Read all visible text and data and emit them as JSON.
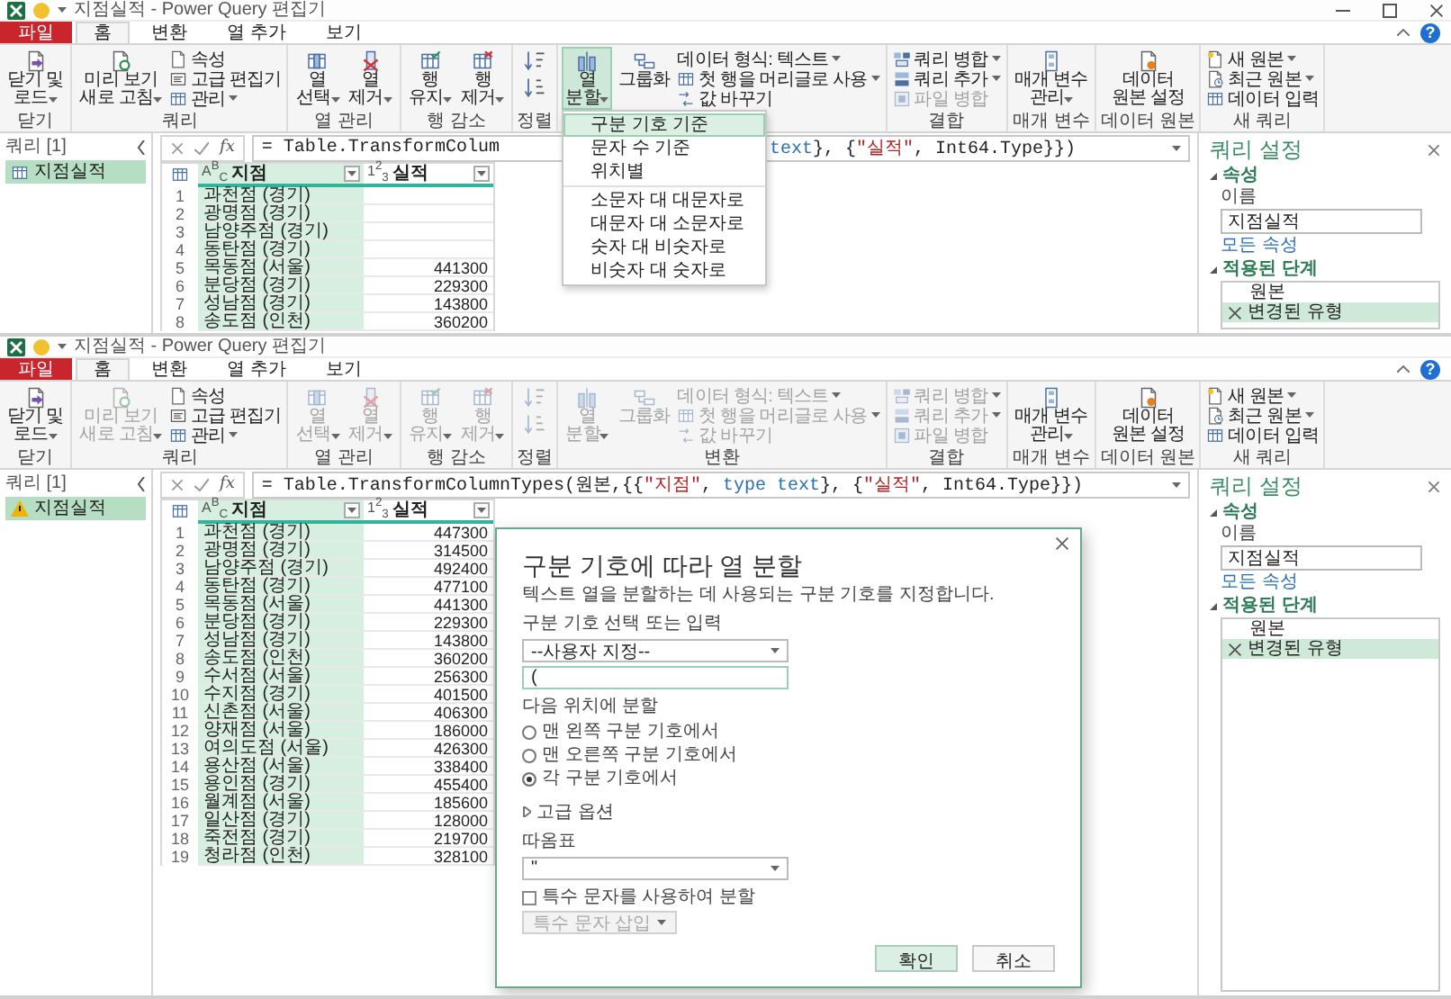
{
  "windows": [
    {
      "title": "지점실적 - Power Query 편집기",
      "window_controls": true,
      "help": "?",
      "tabs": [
        {
          "label": "파일",
          "kind": "file",
          "selected": false
        },
        {
          "label": "홈",
          "kind": "tab",
          "selected": true
        },
        {
          "label": "변환",
          "kind": "tab",
          "selected": false
        },
        {
          "label": "열 추가",
          "kind": "tab",
          "selected": false
        },
        {
          "label": "보기",
          "kind": "tab",
          "selected": false
        }
      ],
      "ribbon": [
        {
          "label": "닫기",
          "items": [
            {
              "kind": "large",
              "lines": [
                "닫기 및",
                "로드"
              ],
              "dropdown": true,
              "disabled": false,
              "pressed": false
            }
          ]
        },
        {
          "label": "쿼리",
          "items": [
            {
              "kind": "large",
              "lines": [
                "미리 보기",
                "새로 고침"
              ],
              "dropdown": true,
              "disabled": false,
              "pressed": false
            },
            {
              "kind": "stack",
              "items": [
                {
                  "label": "속성",
                  "dropdown": false,
                  "disabled": false
                },
                {
                  "label": "고급 편집기",
                  "dropdown": false,
                  "disabled": false
                },
                {
                  "label": "관리",
                  "dropdown": true,
                  "disabled": false
                }
              ]
            }
          ]
        },
        {
          "label": "열 관리",
          "items": [
            {
              "kind": "large",
              "lines": [
                "열",
                "선택"
              ],
              "dropdown": true,
              "disabled": false,
              "pressed": false
            },
            {
              "kind": "large",
              "lines": [
                "열",
                "제거"
              ],
              "dropdown": true,
              "disabled": false,
              "pressed": false
            }
          ]
        },
        {
          "label": "행 감소",
          "items": [
            {
              "kind": "large",
              "lines": [
                "행",
                "유지"
              ],
              "dropdown": true,
              "disabled": false,
              "pressed": false
            },
            {
              "kind": "large",
              "lines": [
                "행",
                "제거"
              ],
              "dropdown": true,
              "disabled": false,
              "pressed": false
            }
          ]
        },
        {
          "label": "정렬",
          "items": [
            {
              "kind": "icons",
              "items": [
                {
                  "disabled": false
                },
                {
                  "disabled": false
                }
              ]
            }
          ]
        },
        {
          "items": [
            {
              "kind": "large",
              "lines": [
                "열",
                "분할"
              ],
              "dropdown": true,
              "disabled": false,
              "pressed": true
            },
            {
              "kind": "large",
              "lines": [
                "그룹화"
              ],
              "dropdown": false,
              "disabled": false,
              "pressed": false
            },
            {
              "kind": "stack",
              "items": [
                {
                  "label": "데이터 형식: 텍스트",
                  "dropdown": true,
                  "disabled": false
                },
                {
                  "label": "첫 행을 머리글로 사용",
                  "dropdown": true,
                  "disabled": false
                },
                {
                  "label": "값 바꾸기",
                  "dropdown": false,
                  "disabled": false
                }
              ]
            }
          ]
        },
        {
          "label": "결합",
          "items": [
            {
              "kind": "stack",
              "items": [
                {
                  "label": "쿼리 병합",
                  "dropdown": true,
                  "disabled": false
                },
                {
                  "label": "쿼리 추가",
                  "dropdown": true,
                  "disabled": false
                },
                {
                  "label": "파일 병합",
                  "dropdown": false,
                  "disabled": true
                }
              ]
            }
          ]
        },
        {
          "label": "매개 변수",
          "items": [
            {
              "kind": "large",
              "lines": [
                "매개 변수",
                "관리"
              ],
              "dropdown": true,
              "disabled": false,
              "pressed": false
            }
          ]
        },
        {
          "label": "데이터 원본",
          "items": [
            {
              "kind": "large",
              "lines": [
                "데이터",
                "원본 설정"
              ],
              "dropdown": false,
              "disabled": false,
              "pressed": false
            }
          ]
        },
        {
          "label": "새 쿼리",
          "items": [
            {
              "kind": "stack",
              "items": [
                {
                  "label": "새 원본",
                  "dropdown": true,
                  "disabled": false
                },
                {
                  "label": "최근 원본",
                  "dropdown": true,
                  "disabled": false
                },
                {
                  "label": "데이터 입력",
                  "dropdown": false,
                  "disabled": false
                }
              ]
            }
          ]
        }
      ],
      "menu": {
        "sections": [
          [
            {
              "label": "구분 기호 기준",
              "selected": true
            },
            {
              "label": "문자 수 기준",
              "selected": false
            },
            {
              "label": "위치별",
              "selected": false
            }
          ],
          [
            {
              "label": "소문자 대 대문자로",
              "selected": false
            },
            {
              "label": "대문자 대 소문자로",
              "selected": false
            },
            {
              "label": "숫자 대 비숫자로",
              "selected": false
            },
            {
              "label": "비숫자 대 숫자로",
              "selected": false
            }
          ]
        ]
      },
      "queries": {
        "title": "쿼리 [1]",
        "items": [
          {
            "label": "지점실적",
            "kind": "table",
            "selected": true
          }
        ]
      },
      "fx": "fx",
      "formula": [
        [
          {
            "kind": "plain",
            "text": "= Table.TransformColum"
          }
        ],
        [
          {
            "kind": "keyword",
            "text": "text"
          },
          {
            "kind": "plain",
            "text": "}, {"
          },
          {
            "kind": "string",
            "text": "\"실적\""
          },
          {
            "kind": "plain",
            "text": ", Int64.Type}})"
          }
        ]
      ],
      "table": {
        "columns": [
          {
            "type_label": "A$^{B}$$_{C}$",
            "name": "지점",
            "selected": true
          },
          {
            "type_label": "1$^{2}$$_{3}$",
            "name": "실적",
            "selected": false
          }
        ],
        "rows": [
          {
            "n": "1",
            "cells": [
              "과천점 (경기)"
            ]
          },
          {
            "n": "2",
            "cells": [
              "광명점 (경기)"
            ]
          },
          {
            "n": "3",
            "cells": [
              "남양주점 (경기)"
            ]
          },
          {
            "n": "4",
            "cells": [
              "동탄점 (경기)"
            ]
          },
          {
            "n": "5",
            "cells": [
              "목동점 (서울)",
              "441300"
            ]
          },
          {
            "n": "6",
            "cells": [
              "분당점 (경기)",
              "229300"
            ]
          },
          {
            "n": "7",
            "cells": [
              "성남점 (경기)",
              "143800"
            ]
          },
          {
            "n": "8",
            "cells": [
              "송도점 (인천)",
              "360200"
            ]
          }
        ]
      },
      "settings": {
        "title": "쿼리 설정",
        "properties": "속성",
        "name_label": "이름",
        "name_value": "지점실적",
        "all_properties": "모든 속성",
        "steps_label": "적용된 단계",
        "steps": [
          {
            "label": "원본",
            "selected": false
          },
          {
            "label": "변경된 유형",
            "selected": true
          }
        ]
      }
    },
    {
      "title": "지점실적 - Power Query 편집기",
      "window_controls": false,
      "help": "?",
      "tabs": [
        {
          "label": "파일",
          "kind": "file",
          "selected": false
        },
        {
          "label": "홈",
          "kind": "tab",
          "selected": true
        },
        {
          "label": "변환",
          "kind": "tab",
          "selected": false
        },
        {
          "label": "열 추가",
          "kind": "tab",
          "selected": false
        },
        {
          "label": "보기",
          "kind": "tab",
          "selected": false
        }
      ],
      "ribbon": [
        {
          "label": "닫기",
          "items": [
            {
              "kind": "large",
              "lines": [
                "닫기 및",
                "로드"
              ],
              "dropdown": true,
              "disabled": false,
              "pressed": false
            }
          ]
        },
        {
          "label": "쿼리",
          "items": [
            {
              "kind": "large",
              "lines": [
                "미리 보기",
                "새로 고침"
              ],
              "dropdown": true,
              "disabled": true,
              "pressed": false
            },
            {
              "kind": "stack",
              "items": [
                {
                  "label": "속성",
                  "dropdown": false,
                  "disabled": false
                },
                {
                  "label": "고급 편집기",
                  "dropdown": false,
                  "disabled": false
                },
                {
                  "label": "관리",
                  "dropdown": true,
                  "disabled": false
                }
              ]
            }
          ]
        },
        {
          "label": "열 관리",
          "items": [
            {
              "kind": "large",
              "lines": [
                "열",
                "선택"
              ],
              "dropdown": true,
              "disabled": true,
              "pressed": false
            },
            {
              "kind": "large",
              "lines": [
                "열",
                "제거"
              ],
              "dropdown": true,
              "disabled": true,
              "pressed": false
            }
          ]
        },
        {
          "label": "행 감소",
          "items": [
            {
              "kind": "large",
              "lines": [
                "행",
                "유지"
              ],
              "dropdown": true,
              "disabled": true,
              "pressed": false
            },
            {
              "kind": "large",
              "lines": [
                "행",
                "제거"
              ],
              "dropdown": true,
              "disabled": true,
              "pressed": false
            }
          ]
        },
        {
          "label": "정렬",
          "items": [
            {
              "kind": "icons",
              "items": [
                {
                  "disabled": true
                },
                {
                  "disabled": true
                }
              ]
            }
          ]
        },
        {
          "label": "변환",
          "items": [
            {
              "kind": "large",
              "lines": [
                "열",
                "분할"
              ],
              "dropdown": true,
              "disabled": true,
              "pressed": false
            },
            {
              "kind": "large",
              "lines": [
                "그룹화"
              ],
              "dropdown": false,
              "disabled": true,
              "pressed": false
            },
            {
              "kind": "stack",
              "items": [
                {
                  "label": "데이터 형식: 텍스트",
                  "dropdown": true,
                  "disabled": true
                },
                {
                  "label": "첫 행을 머리글로 사용",
                  "dropdown": true,
                  "disabled": true
                },
                {
                  "label": "값 바꾸기",
                  "dropdown": false,
                  "disabled": true
                }
              ]
            }
          ]
        },
        {
          "label": "결합",
          "items": [
            {
              "kind": "stack",
              "items": [
                {
                  "label": "쿼리 병합",
                  "dropdown": true,
                  "disabled": true
                },
                {
                  "label": "쿼리 추가",
                  "dropdown": true,
                  "disabled": true
                },
                {
                  "label": "파일 병합",
                  "dropdown": false,
                  "disabled": true
                }
              ]
            }
          ]
        },
        {
          "label": "매개 변수",
          "items": [
            {
              "kind": "large",
              "lines": [
                "매개 변수",
                "관리"
              ],
              "dropdown": true,
              "disabled": false,
              "pressed": false
            }
          ]
        },
        {
          "label": "데이터 원본",
          "items": [
            {
              "kind": "large",
              "lines": [
                "데이터",
                "원본 설정"
              ],
              "dropdown": false,
              "disabled": false,
              "pressed": false
            }
          ]
        },
        {
          "label": "새 쿼리",
          "items": [
            {
              "kind": "stack",
              "items": [
                {
                  "label": "새 원본",
                  "dropdown": true,
                  "disabled": false
                },
                {
                  "label": "최근 원본",
                  "dropdown": true,
                  "disabled": false
                },
                {
                  "label": "데이터 입력",
                  "dropdown": false,
                  "disabled": false
                }
              ]
            }
          ]
        }
      ],
      "queries": {
        "title": "쿼리 [1]",
        "items": [
          {
            "label": "지점실적",
            "kind": "warning",
            "selected": true
          }
        ]
      },
      "fx": "fx",
      "formula": [
        [
          {
            "kind": "plain",
            "text": "= Table.TransformColumnTypes(원본,{{"
          },
          {
            "kind": "string",
            "text": "\"지점\""
          },
          {
            "kind": "plain",
            "text": ", "
          },
          {
            "kind": "keyword",
            "text": "type text"
          },
          {
            "kind": "plain",
            "text": "}, {"
          },
          {
            "kind": "string",
            "text": "\"실적\""
          },
          {
            "kind": "plain",
            "text": ", Int64.Type}})"
          }
        ]
      ],
      "table": {
        "columns": [
          {
            "type_label": "A$^{B}$$_{C}$",
            "name": "지점",
            "selected": true
          },
          {
            "type_label": "1$^{2}$$_{3}$",
            "name": "실적",
            "selected": false
          }
        ],
        "rows": [
          {
            "n": "1",
            "cells": [
              "과천점 (경기)",
              "447300"
            ]
          },
          {
            "n": "2",
            "cells": [
              "광명점 (경기)",
              "314500"
            ]
          },
          {
            "n": "3",
            "cells": [
              "남양주점 (경기)",
              "492400"
            ]
          },
          {
            "n": "4",
            "cells": [
              "동탄점 (경기)",
              "477100"
            ]
          },
          {
            "n": "5",
            "cells": [
              "목동점 (서울)",
              "441300"
            ]
          },
          {
            "n": "6",
            "cells": [
              "분당점 (경기)",
              "229300"
            ]
          },
          {
            "n": "7",
            "cells": [
              "성남점 (경기)",
              "143800"
            ]
          },
          {
            "n": "8",
            "cells": [
              "송도점 (인천)",
              "360200"
            ]
          },
          {
            "n": "9",
            "cells": [
              "수서점 (서울)",
              "256300"
            ]
          },
          {
            "n": "10",
            "cells": [
              "수지점 (경기)",
              "401500"
            ]
          },
          {
            "n": "11",
            "cells": [
              "신촌점 (서울)",
              "406300"
            ]
          },
          {
            "n": "12",
            "cells": [
              "양재점 (서울)",
              "186000"
            ]
          },
          {
            "n": "13",
            "cells": [
              "여의도점 (서울)",
              "426300"
            ]
          },
          {
            "n": "14",
            "cells": [
              "용산점 (서울)",
              "338400"
            ]
          },
          {
            "n": "15",
            "cells": [
              "용인점 (경기)",
              "455400"
            ]
          },
          {
            "n": "16",
            "cells": [
              "월계점 (서울)",
              "185600"
            ]
          },
          {
            "n": "17",
            "cells": [
              "일산점 (경기)",
              "128000"
            ]
          },
          {
            "n": "18",
            "cells": [
              "죽전점 (경기)",
              "219700"
            ]
          },
          {
            "n": "19",
            "cells": [
              "청라점 (인천)",
              "328100"
            ]
          }
        ]
      },
      "settings": {
        "title": "쿼리 설정",
        "properties": "속성",
        "name_label": "이름",
        "name_value": "지점실적",
        "all_properties": "모든 속성",
        "steps_label": "적용된 단계",
        "steps": [
          {
            "label": "원본",
            "selected": false
          },
          {
            "label": "변경된 유형",
            "selected": true
          }
        ]
      },
      "dialog": {
        "title": "구분 기호에 따라 열 분할",
        "description": "텍스트 열을 분할하는 데 사용되는 구분 기호를 지정합니다.",
        "delimiter_label": "구분 기호 선택 또는 입력",
        "delimiter_select": "--사용자 지정--",
        "delimiter_value": "(",
        "split_label": "다음 위치에 분할",
        "split_options": [
          {
            "label": "맨 왼쪽 구분 기호에서",
            "selected": false
          },
          {
            "label": "맨 오른쪽 구분 기호에서",
            "selected": false
          },
          {
            "label": "각 구분 기호에서",
            "selected": true
          }
        ],
        "advanced": {
          "label": "고급 옵션",
          "expanded": false
        },
        "quote_label": "따옴표",
        "quote_value": "\"",
        "special": {
          "label": "특수 문자를 사용하여 분할",
          "checked": false
        },
        "insert": {
          "label": "특수 문자 삽입",
          "disabled": true
        },
        "buttons": [
          {
            "label": "확인",
            "primary": true
          },
          {
            "label": "취소",
            "primary": false
          }
        ]
      }
    }
  ]
}
